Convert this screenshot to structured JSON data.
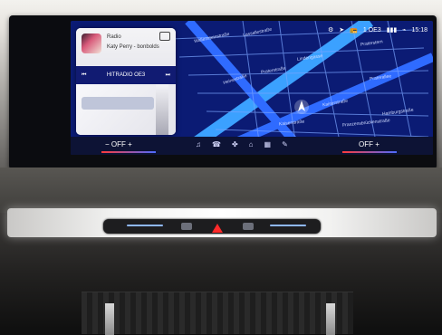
{
  "topbar": {
    "status_text": "1 OE3",
    "time": "15:18",
    "icons": [
      "settings-icon",
      "location-icon",
      "radio-icon",
      "signal-icon",
      "wifi-icon"
    ]
  },
  "media": {
    "source": "Radio",
    "track": "Katy Perry - bonbolds",
    "station": "HITRADIO OE3",
    "buttons": [
      "prev-icon",
      "next-icon",
      "cast-icon"
    ]
  },
  "map_labels": [
    "Lassallestraße",
    "Lindengasse",
    "Praterstraße",
    "Praterstern",
    "Heinestraße",
    "Wallensteinstraße",
    "Kaiserstraße",
    "Praterallee",
    "Hamburgstraße",
    "Franzensbrückenstraße",
    "Kaiserstraße"
  ],
  "climate": {
    "left": "OFF",
    "right": "OFF",
    "minus": "−",
    "plus": "+"
  },
  "controls": {
    "icons": [
      "music-icon",
      "phone-icon",
      "fan-icon",
      "home-icon",
      "apps-icon",
      "settings-icon"
    ]
  }
}
